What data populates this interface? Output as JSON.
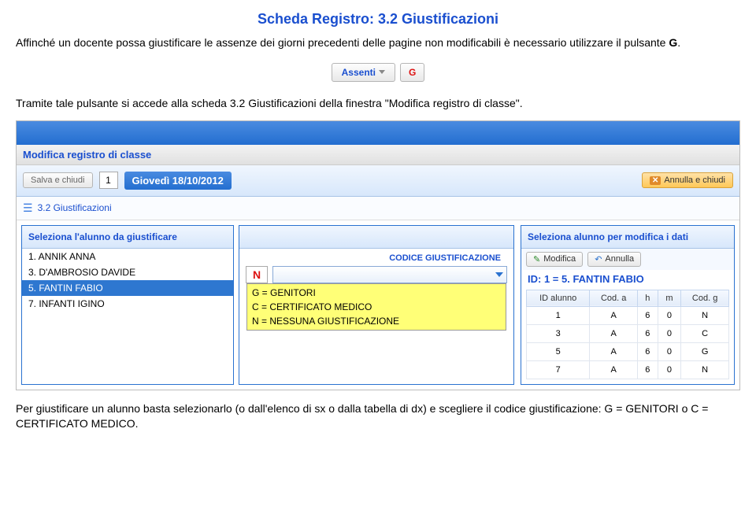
{
  "title": "Scheda Registro: 3.2 Giustificazioni",
  "para1": "Affinché un docente possa giustificare le assenze dei giorni precedenti delle pagine non modificabili è necessario utilizzare il pulsante ",
  "gletter": "G",
  "para1_tail": ".",
  "buttons": {
    "assenti": "Assenti",
    "g": "G"
  },
  "para2": "Tramite tale pulsante si accede alla scheda 3.2 Giustificazioni della finestra \"Modifica registro di classe\".",
  "window": {
    "title": "Modifica registro di classe",
    "save": "Salva e chiudi",
    "page": "1",
    "date": "Giovedì 18/10/2012",
    "cancel": "Annulla e chiudi",
    "crumb": "3.2 Giustificazioni"
  },
  "left": {
    "header": "Seleziona l'alunno da giustificare",
    "items": [
      "1. ANNIK ANNA",
      "3. D'AMBROSIO DAVIDE",
      "5. FANTIN FABIO",
      "7. INFANTI IGINO"
    ]
  },
  "mid": {
    "label": "CODICE GIUSTIFICAZIONE",
    "val": "N",
    "opts": [
      "G = GENITORI",
      "C = CERTIFICATO MEDICO",
      "N = NESSUNA GIUSTIFICAZIONE"
    ]
  },
  "right": {
    "header": "Seleziona alunno per modifica i dati",
    "modify": "Modifica",
    "undo": "Annulla",
    "idline": "ID: 1 = 5. FANTIN FABIO",
    "cols": [
      "ID alunno",
      "Cod. a",
      "h",
      "m",
      "Cod. g"
    ],
    "rows": [
      [
        "1",
        "A",
        "6",
        "0",
        "N"
      ],
      [
        "3",
        "A",
        "6",
        "0",
        "C"
      ],
      [
        "5",
        "A",
        "6",
        "0",
        "G"
      ],
      [
        "7",
        "A",
        "6",
        "0",
        "N"
      ]
    ]
  },
  "para3": "Per giustificare un alunno basta selezionarlo (o dall'elenco di sx o dalla tabella di dx) e scegliere il codice giustificazione: G = GENITORI o C = CERTIFICATO MEDICO."
}
